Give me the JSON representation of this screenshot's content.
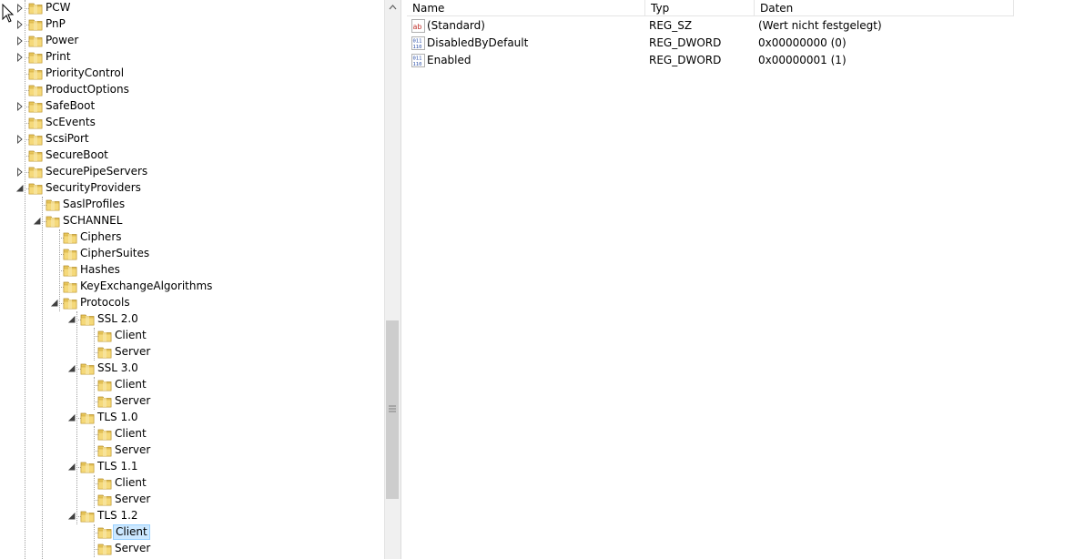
{
  "tree": {
    "items": [
      {
        "label": "PCW",
        "level": 0,
        "state": "collapsed"
      },
      {
        "label": "PnP",
        "level": 0,
        "state": "collapsed"
      },
      {
        "label": "Power",
        "level": 0,
        "state": "collapsed"
      },
      {
        "label": "Print",
        "level": 0,
        "state": "collapsed"
      },
      {
        "label": "PriorityControl",
        "level": 0,
        "state": "none"
      },
      {
        "label": "ProductOptions",
        "level": 0,
        "state": "none"
      },
      {
        "label": "SafeBoot",
        "level": 0,
        "state": "collapsed"
      },
      {
        "label": "ScEvents",
        "level": 0,
        "state": "none"
      },
      {
        "label": "ScsiPort",
        "level": 0,
        "state": "collapsed"
      },
      {
        "label": "SecureBoot",
        "level": 0,
        "state": "none"
      },
      {
        "label": "SecurePipeServers",
        "level": 0,
        "state": "collapsed"
      },
      {
        "label": "SecurityProviders",
        "level": 0,
        "state": "expanded"
      },
      {
        "label": "SaslProfiles",
        "level": 1,
        "state": "none"
      },
      {
        "label": "SCHANNEL",
        "level": 1,
        "state": "expanded"
      },
      {
        "label": "Ciphers",
        "level": 2,
        "state": "none"
      },
      {
        "label": "CipherSuites",
        "level": 2,
        "state": "none"
      },
      {
        "label": "Hashes",
        "level": 2,
        "state": "none"
      },
      {
        "label": "KeyExchangeAlgorithms",
        "level": 2,
        "state": "none"
      },
      {
        "label": "Protocols",
        "level": 2,
        "state": "expanded"
      },
      {
        "label": "SSL 2.0",
        "level": 3,
        "state": "expanded"
      },
      {
        "label": "Client",
        "level": 4,
        "state": "none"
      },
      {
        "label": "Server",
        "level": 4,
        "state": "none"
      },
      {
        "label": "SSL 3.0",
        "level": 3,
        "state": "expanded"
      },
      {
        "label": "Client",
        "level": 4,
        "state": "none"
      },
      {
        "label": "Server",
        "level": 4,
        "state": "none"
      },
      {
        "label": "TLS 1.0",
        "level": 3,
        "state": "expanded"
      },
      {
        "label": "Client",
        "level": 4,
        "state": "none"
      },
      {
        "label": "Server",
        "level": 4,
        "state": "none"
      },
      {
        "label": "TLS 1.1",
        "level": 3,
        "state": "expanded"
      },
      {
        "label": "Client",
        "level": 4,
        "state": "none"
      },
      {
        "label": "Server",
        "level": 4,
        "state": "none"
      },
      {
        "label": "TLS 1.2",
        "level": 3,
        "state": "expanded"
      },
      {
        "label": "Client",
        "level": 4,
        "state": "none",
        "selected": true
      },
      {
        "label": "Server",
        "level": 4,
        "state": "none"
      }
    ]
  },
  "list": {
    "columns": {
      "name": "Name",
      "type": "Typ",
      "data": "Daten"
    },
    "rows": [
      {
        "name": "(Standard)",
        "type": "REG_SZ",
        "data": "(Wert nicht festgelegt)",
        "icon": "string-value-icon"
      },
      {
        "name": "DisabledByDefault",
        "type": "REG_DWORD",
        "data": "0x00000000 (0)",
        "icon": "binary-value-icon"
      },
      {
        "name": "Enabled",
        "type": "REG_DWORD",
        "data": "0x00000001 (1)",
        "icon": "binary-value-icon"
      }
    ]
  },
  "colors": {
    "selection": "#cce8ff",
    "selection_border": "#99d1ff",
    "folder": "#e8c65a",
    "scrollbar": "#f0f0f0",
    "thumb": "#cdcdcd"
  }
}
